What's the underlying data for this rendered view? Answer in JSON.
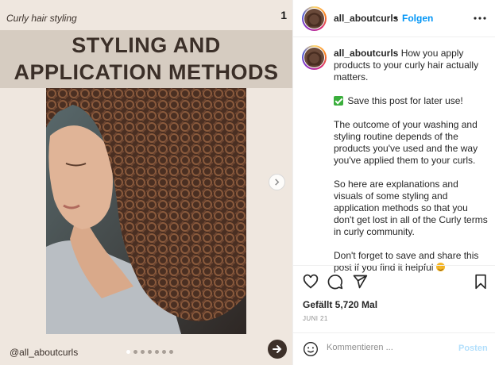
{
  "media": {
    "top_label": "Curly hair styling",
    "slide_number": "1",
    "title_line1": "STYLING AND",
    "title_line2": "APPLICATION METHODS",
    "handle": "@all_aboutcurls",
    "dots_total": 7,
    "dots_active_index": 0
  },
  "header": {
    "username": "all_aboutcurls",
    "separator": "•",
    "follow_label": "Folgen",
    "more_icon": "more-horizontal-icon"
  },
  "caption": {
    "username": "all_aboutcurls",
    "intro": "How you apply products to your curly hair actually matters.",
    "save_note": "Save this post for later use!",
    "paragraph2": "The outcome of your washing and styling routine depends of the products you've used and the way you've applied them to your curls.",
    "paragraph3": "So here are explanations and visuals of some styling and application methods so that you don't get lost in all of the Curly terms in curly community.",
    "paragraph4": "Don't forget to save and share this post if you find it helpful"
  },
  "actions": {
    "icons": [
      "heart-icon",
      "comment-icon",
      "share-icon",
      "bookmark-icon"
    ],
    "likes_text": "Gefällt 5,720 Mal",
    "date_text": "JUNI 21"
  },
  "comment": {
    "placeholder": "Kommentieren ...",
    "post_label": "Posten"
  },
  "colors": {
    "follow_blue": "#0095f6",
    "post_disabled_blue": "#b2dffc",
    "media_bg": "#efe7df",
    "title_band": "#d6ccc1",
    "title_text": "#3b2f28"
  }
}
